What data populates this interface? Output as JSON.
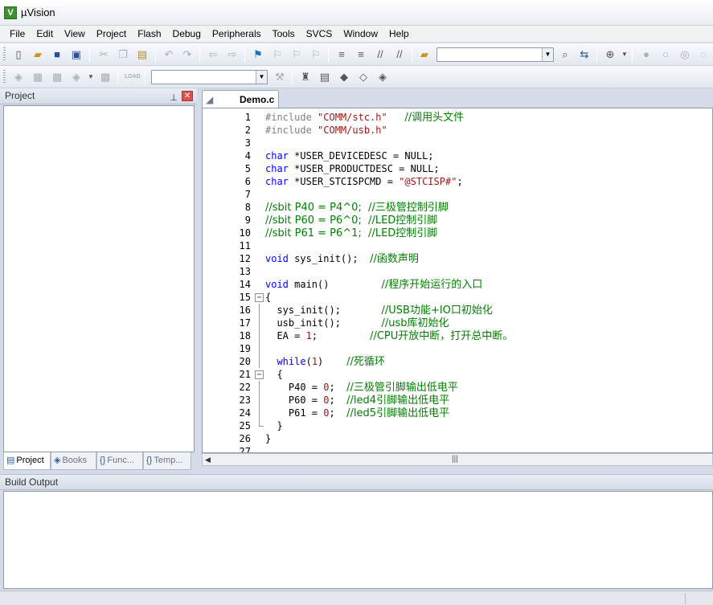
{
  "window": {
    "title": "µVision"
  },
  "menu": [
    "File",
    "Edit",
    "View",
    "Project",
    "Flash",
    "Debug",
    "Peripherals",
    "Tools",
    "SVCS",
    "Window",
    "Help"
  ],
  "project_panel": {
    "title": "Project",
    "tabs": [
      {
        "label": "Project",
        "icon": "project-icon"
      },
      {
        "label": "Books",
        "icon": "books-icon"
      },
      {
        "label": "Func...",
        "icon": "braces-icon"
      },
      {
        "label": "Temp...",
        "icon": "template-icon"
      }
    ]
  },
  "editor": {
    "file_tab": "Demo.c",
    "lines": [
      {
        "n": "1",
        "fold": "",
        "segs": [
          [
            "pp",
            "#include "
          ],
          [
            "str",
            "\"COMM/stc.h\""
          ],
          [
            "txt",
            "   "
          ],
          [
            "cm",
            "//调用头文件"
          ]
        ]
      },
      {
        "n": "2",
        "fold": "",
        "segs": [
          [
            "pp",
            "#include "
          ],
          [
            "str",
            "\"COMM/usb.h\""
          ]
        ]
      },
      {
        "n": "3",
        "fold": "",
        "segs": []
      },
      {
        "n": "4",
        "fold": "",
        "segs": [
          [
            "kw",
            "char"
          ],
          [
            "txt",
            " *USER_DEVICEDESC = NULL;"
          ]
        ]
      },
      {
        "n": "5",
        "fold": "",
        "segs": [
          [
            "kw",
            "char"
          ],
          [
            "txt",
            " *USER_PRODUCTDESC = NULL;"
          ]
        ]
      },
      {
        "n": "6",
        "fold": "",
        "segs": [
          [
            "kw",
            "char"
          ],
          [
            "txt",
            " *USER_STCISPCMD = "
          ],
          [
            "str",
            "\"@STCISP#\""
          ],
          [
            "txt",
            ";"
          ]
        ]
      },
      {
        "n": "7",
        "fold": "",
        "segs": []
      },
      {
        "n": "8",
        "fold": "",
        "segs": [
          [
            "cm",
            "//sbit P40 = P4^0;  //三极管控制引脚"
          ]
        ]
      },
      {
        "n": "9",
        "fold": "",
        "segs": [
          [
            "cm",
            "//sbit P60 = P6^0;  //LED控制引脚"
          ]
        ]
      },
      {
        "n": "10",
        "fold": "",
        "segs": [
          [
            "cm",
            "//sbit P61 = P6^1;  //LED控制引脚"
          ]
        ]
      },
      {
        "n": "11",
        "fold": "",
        "segs": []
      },
      {
        "n": "12",
        "fold": "",
        "segs": [
          [
            "kw",
            "void"
          ],
          [
            "txt",
            " sys_init();  "
          ],
          [
            "cm",
            "//函数声明"
          ]
        ]
      },
      {
        "n": "13",
        "fold": "",
        "segs": []
      },
      {
        "n": "14",
        "fold": "",
        "segs": [
          [
            "kw",
            "void"
          ],
          [
            "txt",
            " main()         "
          ],
          [
            "cm",
            "//程序开始运行的入口"
          ]
        ]
      },
      {
        "n": "15",
        "fold": "open",
        "segs": [
          [
            "txt",
            "{"
          ]
        ]
      },
      {
        "n": "16",
        "fold": "line",
        "segs": [
          [
            "txt",
            "  sys_init();       "
          ],
          [
            "cm",
            "//USB功能+IO口初始化"
          ]
        ]
      },
      {
        "n": "17",
        "fold": "line",
        "segs": [
          [
            "txt",
            "  usb_init();       "
          ],
          [
            "cm",
            "//usb库初始化"
          ]
        ]
      },
      {
        "n": "18",
        "fold": "line",
        "segs": [
          [
            "txt",
            "  EA = "
          ],
          [
            "num",
            "1"
          ],
          [
            "txt",
            ";         "
          ],
          [
            "cm",
            "//CPU开放中断，打开总中断。"
          ]
        ]
      },
      {
        "n": "19",
        "fold": "line",
        "segs": []
      },
      {
        "n": "20",
        "fold": "line",
        "segs": [
          [
            "txt",
            "  "
          ],
          [
            "kw",
            "while"
          ],
          [
            "txt",
            "("
          ],
          [
            "num",
            "1"
          ],
          [
            "txt",
            ")    "
          ],
          [
            "cm",
            "//死循环"
          ]
        ]
      },
      {
        "n": "21",
        "fold": "open",
        "segs": [
          [
            "txt",
            "  {"
          ]
        ]
      },
      {
        "n": "22",
        "fold": "line",
        "segs": [
          [
            "txt",
            "    P40 = "
          ],
          [
            "num",
            "0"
          ],
          [
            "txt",
            ";  "
          ],
          [
            "cm",
            "//三极管引脚输出低电平"
          ]
        ]
      },
      {
        "n": "23",
        "fold": "line",
        "segs": [
          [
            "txt",
            "    P60 = "
          ],
          [
            "num",
            "0"
          ],
          [
            "txt",
            ";  "
          ],
          [
            "cm",
            "//led4引脚输出低电平"
          ]
        ]
      },
      {
        "n": "24",
        "fold": "line",
        "segs": [
          [
            "txt",
            "    P61 = "
          ],
          [
            "num",
            "0"
          ],
          [
            "txt",
            ";  "
          ],
          [
            "cm",
            "//led5引脚输出低电平"
          ]
        ]
      },
      {
        "n": "25",
        "fold": "end",
        "segs": [
          [
            "txt",
            "  }"
          ]
        ]
      },
      {
        "n": "26",
        "fold": "",
        "segs": [
          [
            "txt",
            "}"
          ]
        ]
      },
      {
        "n": "27",
        "fold": "",
        "segs": []
      }
    ]
  },
  "build_output": {
    "title": "Build Output"
  },
  "load_label": "LOAD",
  "colors": {
    "keyword": "#0000ff",
    "comment": "#008000",
    "string": "#a31515",
    "preprocessor": "#808080"
  }
}
